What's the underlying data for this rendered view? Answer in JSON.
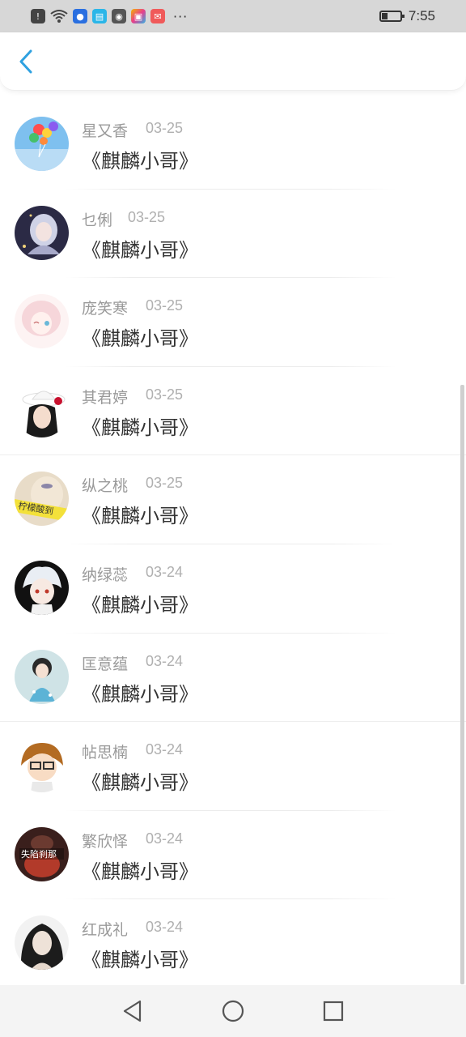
{
  "status_bar": {
    "time": "7:55",
    "dots": "···"
  },
  "colors": {
    "accent": "#2fa1e0",
    "name": "#9a9a9a",
    "date": "#b0b0b0",
    "title": "#333333"
  },
  "comments": [
    {
      "name": "星又香",
      "date": "03-25",
      "title": "《麒麟小哥》",
      "avatar": "balloons"
    },
    {
      "name": "乜俐",
      "date": "03-25",
      "title": "《麒麟小哥》",
      "avatar": "anime-girl-dark"
    },
    {
      "name": "庞笑寒",
      "date": "03-25",
      "title": "《麒麟小哥》",
      "avatar": "anime-girl-pink"
    },
    {
      "name": "其君婷",
      "date": "03-25",
      "title": "《麒麟小哥》",
      "avatar": "girl-hat"
    },
    {
      "name": "纵之桃",
      "date": "03-25",
      "title": "《麒麟小哥》",
      "avatar": "yellow-text"
    },
    {
      "name": "纳绿蕊",
      "date": "03-24",
      "title": "《麒麟小哥》",
      "avatar": "anime-boy-white"
    },
    {
      "name": "匡意蕴",
      "date": "03-24",
      "title": "《麒麟小哥》",
      "avatar": "doll-blue"
    },
    {
      "name": "帖思楠",
      "date": "03-24",
      "title": "《麒麟小哥》",
      "avatar": "cartoon-glasses"
    },
    {
      "name": "繁欣怿",
      "date": "03-24",
      "title": "《麒麟小哥》",
      "avatar": "dark-red-text"
    },
    {
      "name": "红成礼",
      "date": "03-24",
      "title": "《麒麟小哥》",
      "avatar": "long-hair-man"
    }
  ]
}
